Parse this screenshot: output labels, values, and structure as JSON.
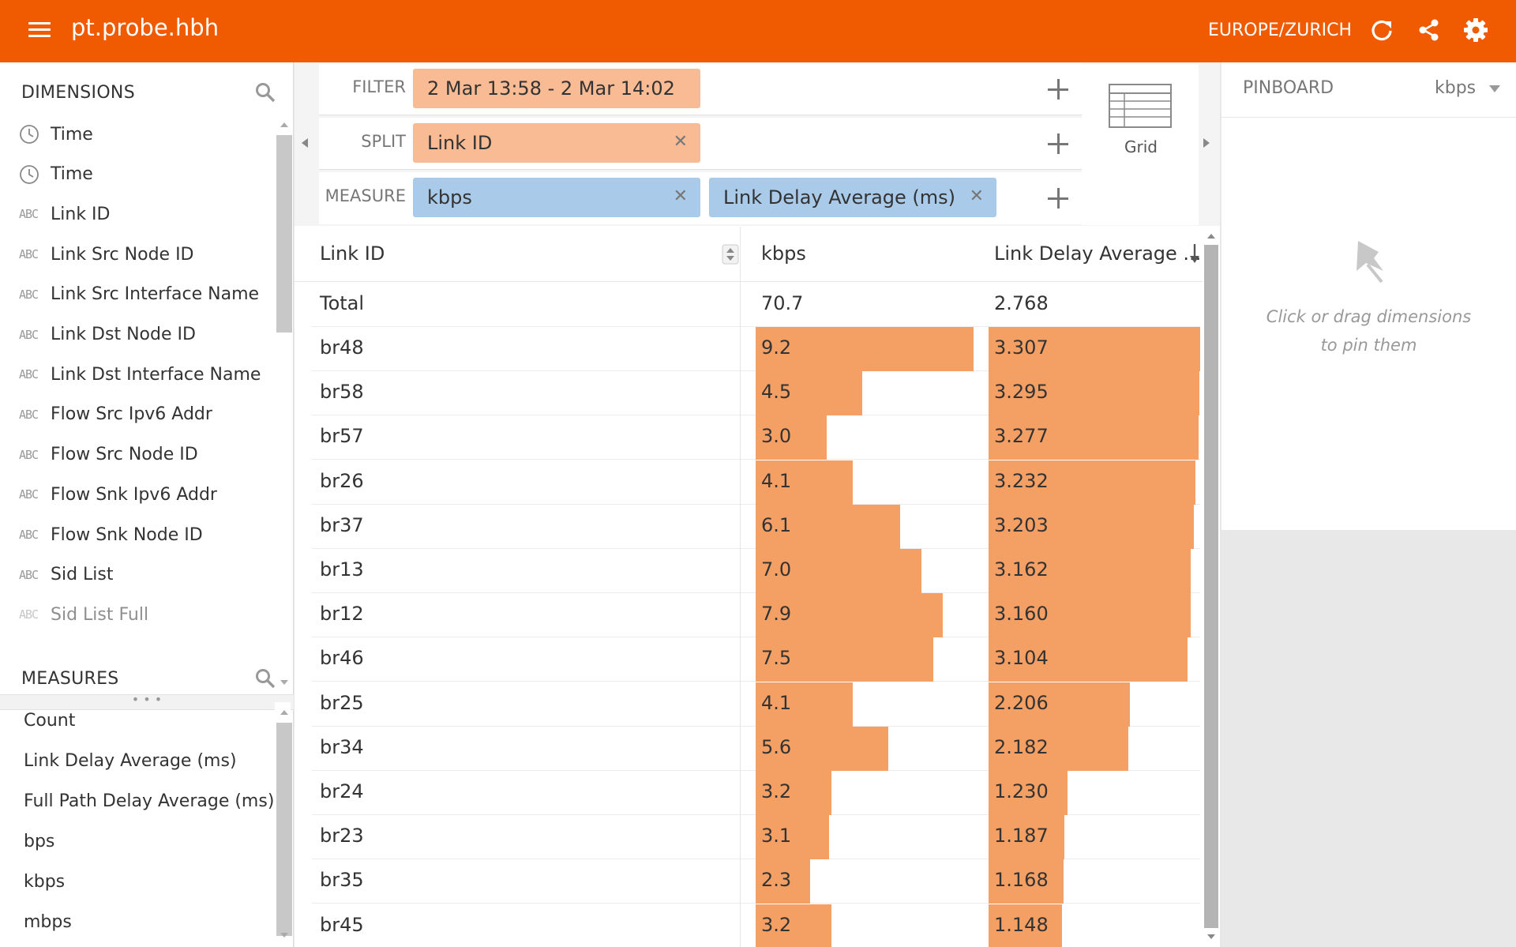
{
  "header": {
    "title": "pt.probe.hbh",
    "timezone": "EUROPE/ZURICH",
    "bg_color": "#f05a00"
  },
  "dimensions": {
    "title": "DIMENSIONS",
    "items": [
      {
        "label": "Time",
        "icon": "clock-icon"
      },
      {
        "label": "Time",
        "icon": "clock-icon"
      },
      {
        "label": "Link ID",
        "icon": "abc-icon"
      },
      {
        "label": "Link Src Node ID",
        "icon": "abc-icon"
      },
      {
        "label": "Link Src Interface Name",
        "icon": "abc-icon"
      },
      {
        "label": "Link Dst Node ID",
        "icon": "abc-icon"
      },
      {
        "label": "Link Dst Interface Name",
        "icon": "abc-icon"
      },
      {
        "label": "Flow Src Ipv6 Addr",
        "icon": "abc-icon"
      },
      {
        "label": "Flow Src Node ID",
        "icon": "abc-icon"
      },
      {
        "label": "Flow Snk Ipv6 Addr",
        "icon": "abc-icon"
      },
      {
        "label": "Flow Snk Node ID",
        "icon": "abc-icon"
      },
      {
        "label": "Sid List",
        "icon": "abc-icon"
      },
      {
        "label": "Sid List Full",
        "icon": "abc-icon"
      }
    ]
  },
  "measures": {
    "title": "MEASURES",
    "items": [
      "Count",
      "Link Delay Average (ms)",
      "Full Path Delay Average (ms)",
      "bps",
      "kbps",
      "mbps"
    ]
  },
  "controls": {
    "filter_label": "FILTER",
    "filter_value": "2 Mar 13:58 - 2 Mar 14:02",
    "split_label": "SPLIT",
    "split_value": "Link ID",
    "measure_label": "MEASURE",
    "measure_values": [
      "kbps",
      "Link Delay Average (ms)"
    ],
    "viz_label": "Grid"
  },
  "pinboard": {
    "title": "PINBOARD",
    "measure": "kbps",
    "hint_line1": "Click or drag dimensions",
    "hint_line2": "to pin them"
  },
  "table": {
    "headers": [
      "Link ID",
      "kbps",
      "Link Delay Average ..."
    ],
    "total": {
      "label": "Total",
      "kbps": "70.7",
      "delay": "2.768"
    },
    "kbps_max": 9.2,
    "delay_max": 3.307,
    "bar_color": "#f4a064",
    "rows": [
      {
        "id": "br48",
        "kbps": "9.2",
        "delay": "3.307"
      },
      {
        "id": "br58",
        "kbps": "4.5",
        "delay": "3.295"
      },
      {
        "id": "br57",
        "kbps": "3.0",
        "delay": "3.277"
      },
      {
        "id": "br26",
        "kbps": "4.1",
        "delay": "3.232"
      },
      {
        "id": "br37",
        "kbps": "6.1",
        "delay": "3.203"
      },
      {
        "id": "br13",
        "kbps": "7.0",
        "delay": "3.162"
      },
      {
        "id": "br12",
        "kbps": "7.9",
        "delay": "3.160"
      },
      {
        "id": "br46",
        "kbps": "7.5",
        "delay": "3.104"
      },
      {
        "id": "br25",
        "kbps": "4.1",
        "delay": "2.206"
      },
      {
        "id": "br34",
        "kbps": "5.6",
        "delay": "2.182"
      },
      {
        "id": "br24",
        "kbps": "3.2",
        "delay": "1.230"
      },
      {
        "id": "br23",
        "kbps": "3.1",
        "delay": "1.187"
      },
      {
        "id": "br35",
        "kbps": "2.3",
        "delay": "1.168"
      },
      {
        "id": "br45",
        "kbps": "3.2",
        "delay": "1.148"
      }
    ]
  }
}
